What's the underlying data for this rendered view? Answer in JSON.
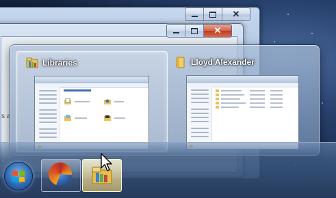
{
  "peek": {
    "cards": [
      {
        "title": "Libraries",
        "state": "hover"
      },
      {
        "title": "Lloyd Alexander",
        "state": "normal"
      }
    ]
  },
  "window_controls": {
    "minimize": "minimize",
    "maximize": "maximize",
    "close": "✕"
  },
  "taskbar": {
    "buttons": [
      {
        "name": "Start",
        "icon": "windows-orb-icon"
      },
      {
        "name": "Firefox",
        "icon": "firefox-icon"
      },
      {
        "name": "Windows Explorer",
        "icon": "folder-icon",
        "active": true
      }
    ]
  },
  "background_text": "s a",
  "colors": {
    "close_red": "#c03a1e",
    "accent_blue": "#2d6bb3",
    "folder": "#e8c25a"
  }
}
